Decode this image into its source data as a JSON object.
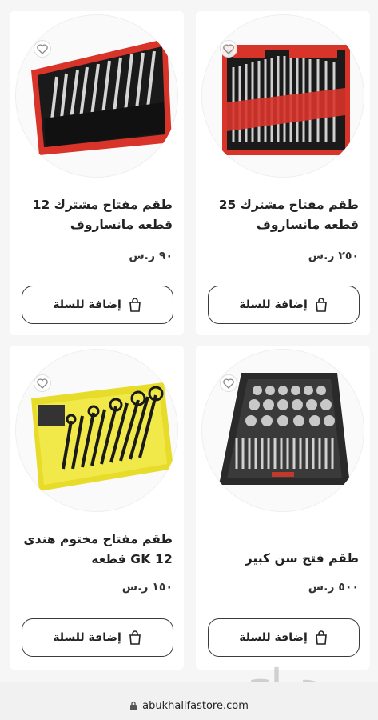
{
  "products": [
    {
      "title_line1": "طقم مفتاح مشترك 25",
      "title_line2": "قطعه مانساروف",
      "price": "٢٥٠ ر.س",
      "add_label": "إضافة للسلة",
      "image": "combination-wrench-set-25-red"
    },
    {
      "title_line1": "طقم مفتاح مشترك 12",
      "title_line2": "قطعه مانساروف",
      "price": "٩٠ ر.س",
      "add_label": "إضافة للسلة",
      "image": "combination-wrench-set-12-red"
    },
    {
      "title_line1": "طقم فتح سن كبير",
      "price": "٥٠٠ ر.س",
      "add_label": "إضافة للسلة",
      "image": "tap-and-die-set-case"
    },
    {
      "title_line1": "طقم مفتاح مختوم هندي",
      "title_line2": "GK 12 قطعه",
      "price": "١٥٠ ر.س",
      "add_label": "إضافة للسلة",
      "image": "ring-spanner-set-yellow"
    }
  ],
  "browser": {
    "url": "abukhalifastore.com"
  },
  "watermark": "حراج",
  "colors": {
    "pouch_red": "#d8342a",
    "pouch_yellow": "#e8dc2a",
    "button_border": "#3a3a3a"
  }
}
